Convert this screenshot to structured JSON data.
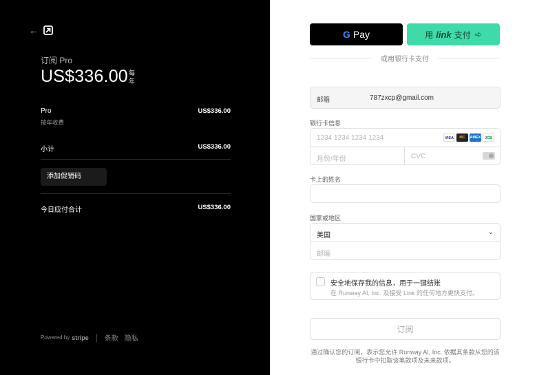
{
  "summary": {
    "plan_label": "订阅 Pro",
    "price": "US$336.00",
    "period": "每年",
    "line_item_name": "Pro",
    "line_item_sub": "按年收费",
    "line_item_price": "US$336.00",
    "subtotal_label": "小计",
    "subtotal_value": "US$336.00",
    "promo_label": "添加促销码",
    "total_label": "今日应付合计",
    "total_value": "US$336.00"
  },
  "footer": {
    "powered_by": "Powered by",
    "stripe": "stripe",
    "terms": "条款",
    "privacy": "隐私"
  },
  "payment": {
    "gpay_label": "Pay",
    "link_prefix": "用",
    "link_brand": "link",
    "link_suffix": "支付",
    "or_text": "或用银行卡支付",
    "email_label": "邮箱",
    "email_value": "787zxcp@gmail.com",
    "card_label": "银行卡信息",
    "card_placeholder": "1234 1234 1234 1234",
    "expiry_placeholder": "月份/年份",
    "cvc_placeholder": "CVC",
    "name_label": "卡上的姓名",
    "country_label": "国家或地区",
    "country_value": "美国",
    "zip_placeholder": "邮编",
    "save_title": "安全地保存我的信息，用于一键结账",
    "save_sub": "在 Runway AI, Inc. 及接受 Link 的任何地方更快支付。",
    "subscribe_label": "订阅",
    "terms_text": "通过确认您的订阅，表示您允许 Runway AI, Inc. 依据其条款从您的该银行卡中扣取该笔款项及未来款项。"
  },
  "colors": {
    "left_bg": "#000000",
    "link_green": "#3ddbaa"
  },
  "icons": [
    "back-arrow-icon",
    "runway-logo",
    "google-g-icon",
    "link-arrow-icon",
    "chevron-down-icon",
    "cvc-card-icon"
  ],
  "card_brands": [
    "VISA",
    "MC",
    "AMEX",
    "JCB"
  ]
}
